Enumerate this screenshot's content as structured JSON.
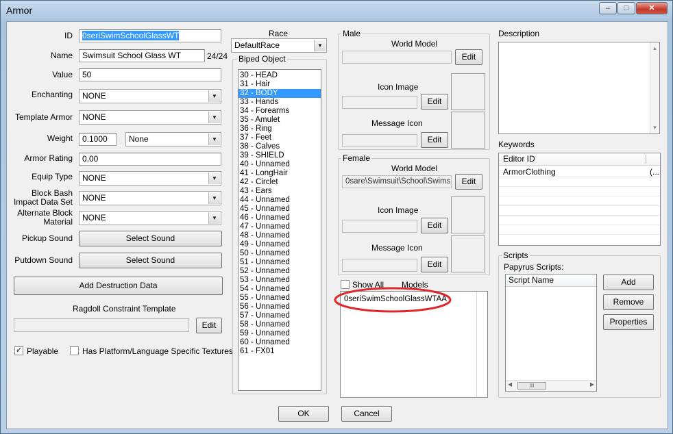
{
  "window": {
    "title": "Armor"
  },
  "fields": {
    "id_label": "ID",
    "id_value": "0seriSwimSchoolGlassWT",
    "name_label": "Name",
    "name_value": "Swimsuit School Glass WT",
    "name_count": "24/24",
    "value_label": "Value",
    "value_value": "50",
    "enchanting_label": "Enchanting",
    "enchanting_value": "NONE",
    "template_label": "Template Armor",
    "template_value": "NONE",
    "weight_label": "Weight",
    "weight_value": "0.1000",
    "weight_type": "None",
    "armor_rating_label": "Armor Rating",
    "armor_rating_value": "0.00",
    "equip_type_label": "Equip Type",
    "equip_type_value": "NONE",
    "block_bash_label_1": "Block Bash",
    "block_bash_label_2": "Impact Data Set",
    "block_bash_value": "NONE",
    "alt_block_label_1": "Alternate Block",
    "alt_block_label_2": "Material",
    "alt_block_value": "NONE",
    "pickup_label": "Pickup Sound",
    "pickup_button": "Select Sound",
    "putdown_label": "Putdown Sound",
    "putdown_button": "Select Sound",
    "add_destruction_button": "Add Destruction Data",
    "ragdoll_label": "Ragdoll Constraint Template",
    "ragdoll_edit": "Edit",
    "playable_label": "Playable",
    "platform_label": "Has Platform/Language Specific Textures"
  },
  "race": {
    "label": "Race",
    "value": "DefaultRace",
    "biped_label": "Biped Object",
    "biped_items": [
      "30 - HEAD",
      "31 - Hair",
      "32 - BODY",
      "33 - Hands",
      "34 - Forearms",
      "35 - Amulet",
      "36 - Ring",
      "37 - Feet",
      "38 - Calves",
      "39 - SHIELD",
      "40 - Unnamed",
      "41 - LongHair",
      "42 - Circlet",
      "43 - Ears",
      "44 - Unnamed",
      "45 - Unnamed",
      "46 - Unnamed",
      "47 - Unnamed",
      "48 - Unnamed",
      "49 - Unnamed",
      "50 - Unnamed",
      "51 - Unnamed",
      "52 - Unnamed",
      "53 - Unnamed",
      "54 - Unnamed",
      "55 - Unnamed",
      "56 - Unnamed",
      "57 - Unnamed",
      "58 - Unnamed",
      "59 - Unnamed",
      "60 - Unnamed",
      "61 - FX01"
    ],
    "selected_index": 2
  },
  "male": {
    "title": "Male",
    "world_model_label": "World Model",
    "world_model_value": "",
    "edit": "Edit",
    "icon_image_label": "Icon Image",
    "message_icon_label": "Message Icon"
  },
  "female": {
    "title": "Female",
    "world_model_label": "World Model",
    "world_model_value": "0sare\\Swimsuit\\School\\Swimsui",
    "edit": "Edit",
    "icon_image_label": "Icon Image",
    "message_icon_label": "Message Icon"
  },
  "models": {
    "show_all_label": "Show All",
    "models_header": "Models",
    "items": [
      "0seriSwimSchoolGlassWTAA"
    ]
  },
  "description": {
    "label": "Description",
    "value": ""
  },
  "keywords": {
    "label": "Keywords",
    "header": "Editor ID",
    "rows": [
      {
        "id": "ArmorClothing",
        "extra": "(..."
      }
    ]
  },
  "scripts": {
    "title": "Scripts",
    "papyrus_label": "Papyrus Scripts:",
    "header": "Script Name",
    "add": "Add",
    "remove": "Remove",
    "properties": "Properties",
    "scroll_grip": "III"
  },
  "footer": {
    "ok": "OK",
    "cancel": "Cancel"
  },
  "colors": {
    "selection": "#3399ff",
    "annotation": "#e0262a"
  },
  "icons": {
    "restore": "restore-icon",
    "minimize": "minimize-icon",
    "close": "close-icon"
  }
}
